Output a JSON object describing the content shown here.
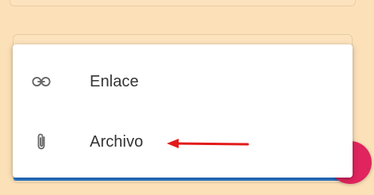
{
  "menu": {
    "items": [
      {
        "label": "Enlace",
        "icon": "link-icon"
      },
      {
        "label": "Archivo",
        "icon": "paperclip-icon"
      }
    ]
  },
  "colors": {
    "background": "#fce0b8",
    "menu_background": "#ffffff",
    "accent_blue": "#2b7bd6",
    "fab": "#e0245e",
    "annotation_arrow": "#e31b1b"
  }
}
